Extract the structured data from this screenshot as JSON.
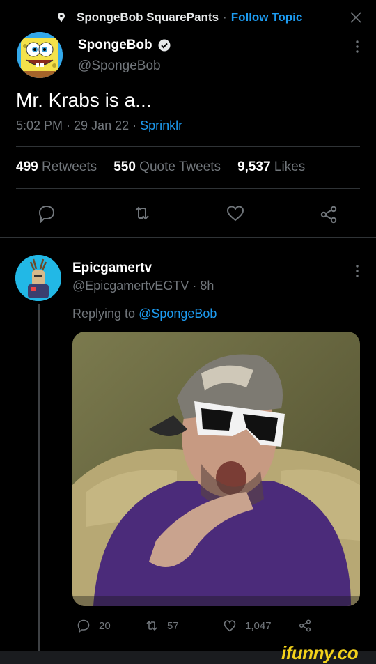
{
  "header": {
    "topic_name": "SpongeBob SquarePants",
    "separator": "·",
    "follow_label": "Follow Topic"
  },
  "tweet": {
    "display_name": "SpongeBob",
    "handle": "@SpongeBob",
    "text": "Mr. Krabs is a...",
    "time": "5:02 PM · 29 Jan 22 · ",
    "source": "Sprinklr",
    "stats": {
      "retweets_count": "499",
      "retweets_label": "Retweets",
      "quote_count": "550",
      "quote_label": "Quote Tweets",
      "likes_count": "9,537",
      "likes_label": "Likes"
    }
  },
  "reply": {
    "display_name": "Epicgamertv",
    "handle_time": "@EpicgamertvEGTV · 8h",
    "replying_prefix": "Replying to ",
    "replying_to": "@SpongeBob",
    "reply_count": "20",
    "retweet_count": "57",
    "like_count": "1,047"
  },
  "watermark": "ifunny.co",
  "icons": [
    "topic-pin-icon",
    "close-icon",
    "verified-badge-icon",
    "more-icon",
    "reply-icon",
    "retweet-icon",
    "like-icon",
    "share-icon"
  ],
  "colors": {
    "accent": "#1d9bf0",
    "muted": "#71767b",
    "background": "#000000",
    "watermark": "#f3d21a"
  }
}
